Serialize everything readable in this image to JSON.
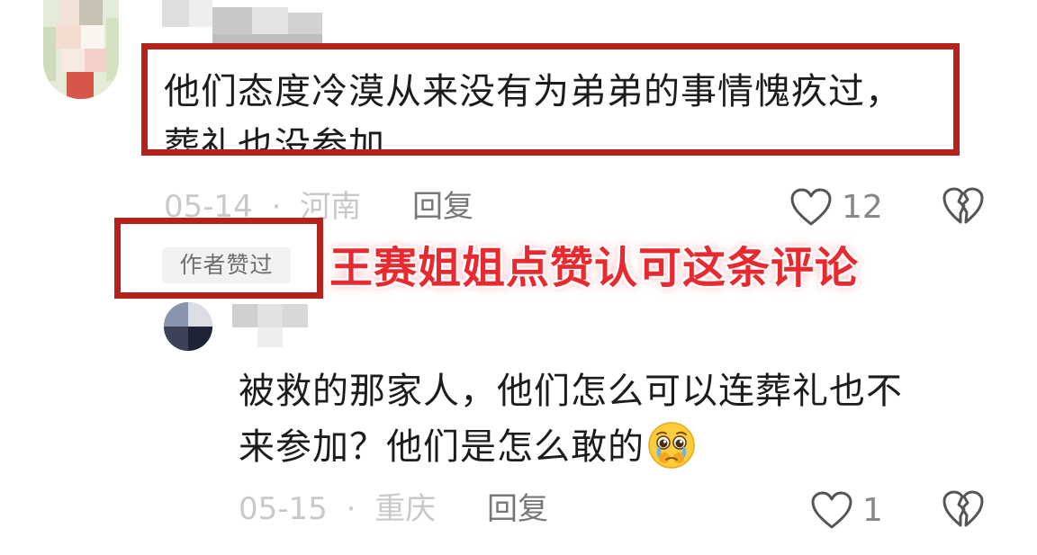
{
  "comments": [
    {
      "text_lines": [
        "他们态度冷漠从来没有为弟弟的事情愧疚过，",
        "葬礼也没参加"
      ],
      "date": "05-14",
      "separator": "·",
      "location": "河南",
      "reply_label": "回复",
      "likes": "12",
      "author_liked_badge": "作者赞过"
    },
    {
      "text_lines": [
        "被救的那家人，他们怎么可以连葬礼也不",
        "来参加？他们是怎么敢的"
      ],
      "emoji": "pleading-crying-face",
      "date": "05-15",
      "separator": "·",
      "location": "重庆",
      "reply_label": "回复",
      "likes": "1"
    }
  ],
  "annotation": {
    "text": "王赛姐姐点赞认可这条评论",
    "color": "#e82a30"
  },
  "highlight_color": "#b5211b",
  "icons": {
    "like": "heart-outline-icon",
    "dislike": "broken-heart-icon"
  }
}
